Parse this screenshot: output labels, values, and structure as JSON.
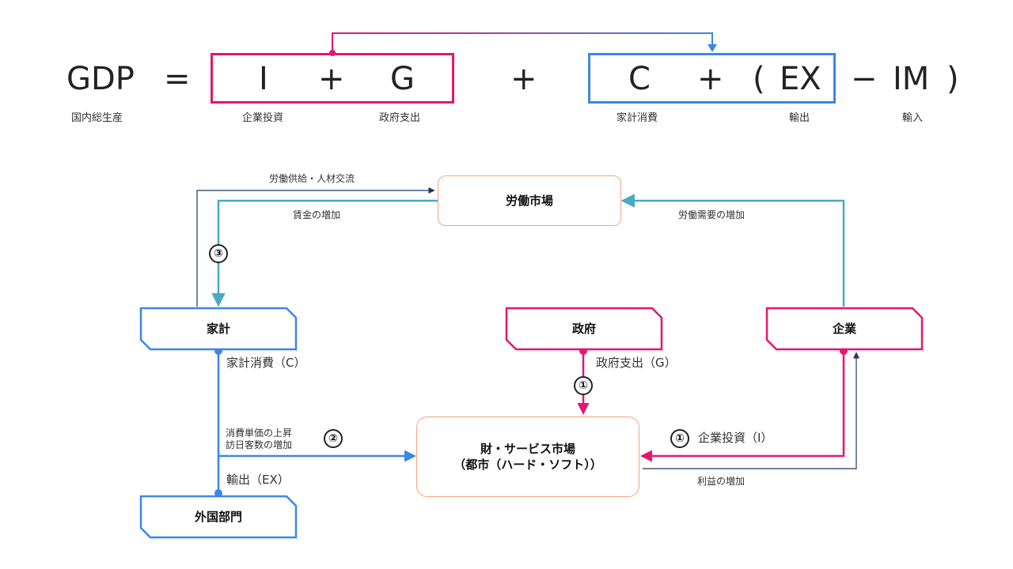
{
  "colors": {
    "pink": "#e6166f",
    "blue": "#3b87e8",
    "teal": "#4aaac4",
    "navy": "#1f3864",
    "orange": "#f4a582"
  },
  "equation": {
    "gdp": "GDP",
    "equals": "=",
    "i": "I",
    "plus1": "+",
    "g": "G",
    "plus2": "+",
    "c": "C",
    "plus3": "+",
    "open_paren": "(",
    "ex": "EX",
    "minus": "−",
    "im": "IM",
    "close_paren": ")",
    "labels": {
      "gdp": "国内総生産",
      "i": "企業投資",
      "g": "政府支出",
      "c": "家計消費",
      "ex": "輸出",
      "im": "輸入"
    }
  },
  "nodes": {
    "labor_market": "労働市場",
    "household": "家計",
    "government": "政府",
    "company": "企業",
    "goods_market_line1": "財・サービス市場",
    "goods_market_line2": "（都市（ハード・ソフト））",
    "foreign": "外国部門"
  },
  "edge_labels": {
    "labor_supply": "労働供給・人材交流",
    "wage_increase": "賃金の増加",
    "labor_demand": "労働需要の増加",
    "household_consumption": "家計消費（C）",
    "government_spending": "政府支出（G）",
    "company_investment": "企業投資（I）",
    "price_rise": "消費単価の上昇",
    "visitors_increase": "訪日客数の増加",
    "exports": "輸出（EX）",
    "profit_increase": "利益の増加"
  },
  "badges": {
    "one": "①",
    "two": "②",
    "three": "③"
  }
}
